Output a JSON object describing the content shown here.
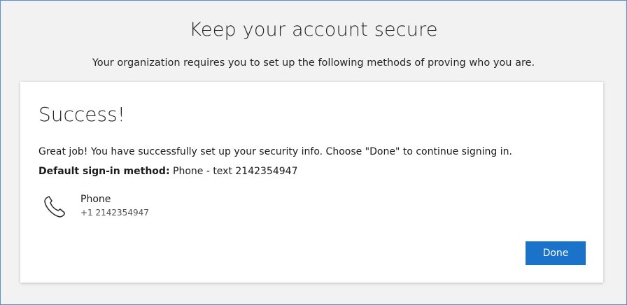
{
  "page": {
    "title": "Keep your account secure",
    "subtitle": "Your organization requires you to set up the following methods of proving who you are."
  },
  "card": {
    "heading": "Success!",
    "message": "Great job! You have successfully set up your security info. Choose \"Done\" to continue signing in.",
    "default_method_label": "Default sign-in method:",
    "default_method_value": "Phone - text 2142354947",
    "method": {
      "icon": "phone-icon",
      "name": "Phone",
      "number": "+1 2142354947"
    },
    "done_label": "Done"
  },
  "colors": {
    "accent": "#1a73c9",
    "background": "#f2f2f2",
    "card": "#ffffff",
    "frame_border": "#5b8ed6"
  }
}
